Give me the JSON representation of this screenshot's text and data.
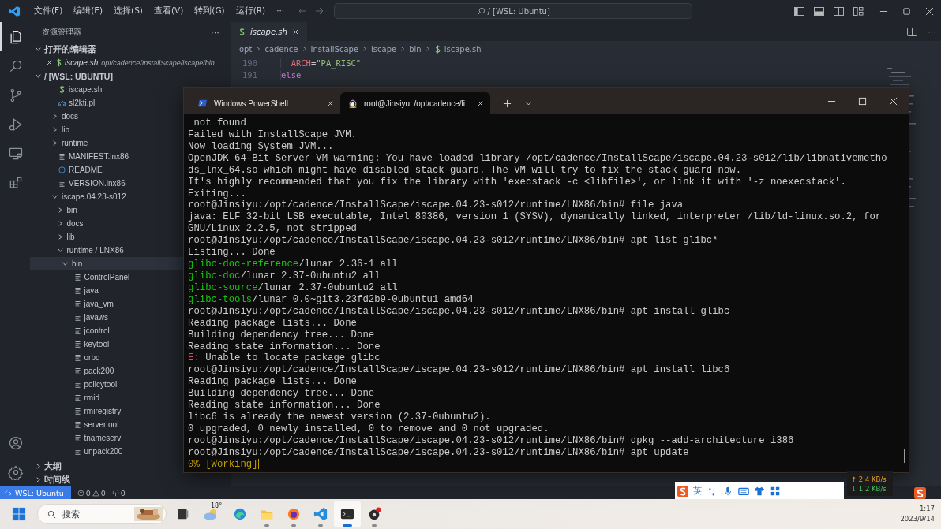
{
  "menu": [
    "文件(F)",
    "编辑(E)",
    "选择(S)",
    "查看(V)",
    "转到(G)",
    "运行(R)",
    "···"
  ],
  "command_center": {
    "text": "/ [WSL: Ubuntu]"
  },
  "activity_bar": [
    {
      "kind": "explorer",
      "selected": true
    },
    {
      "kind": "search",
      "selected": false
    },
    {
      "kind": "source-control",
      "selected": false
    },
    {
      "kind": "run",
      "selected": false
    },
    {
      "kind": "remote",
      "selected": false
    },
    {
      "kind": "extensions",
      "selected": false
    }
  ],
  "sidebar": {
    "title": "资源管理器",
    "more": "···",
    "open_editors": {
      "title": "打开的编辑器",
      "expanded": true,
      "items": [
        {
          "name": "iscape.sh",
          "path": "opt/cadence/InstallScape/iscape/bin"
        }
      ]
    },
    "workspace": {
      "title": "/ [WSL: UBUNTU]",
      "expanded": true,
      "tree": [
        {
          "label": "iscape.sh",
          "kind": "shell",
          "selected": false
        },
        {
          "label": "sl2kti.pl",
          "kind": "perl",
          "selected": false
        },
        {
          "label": "docs",
          "kind": "folder",
          "expanded": false,
          "selected": false
        },
        {
          "label": "lib",
          "kind": "folder",
          "expanded": false,
          "selected": false
        },
        {
          "label": "runtime",
          "kind": "folder",
          "expanded": false,
          "selected": false
        },
        {
          "label": "MANIFEST.lnx86",
          "kind": "text",
          "selected": false
        },
        {
          "label": "README",
          "kind": "info",
          "selected": false
        },
        {
          "label": "VERSION.lnx86",
          "kind": "text",
          "selected": false
        },
        {
          "label": "iscape.04.23-s012",
          "kind": "folder",
          "expanded": true,
          "selected": false,
          "children": [
            {
              "label": "bin",
              "kind": "folder",
              "expanded": false,
              "selected": false
            },
            {
              "label": "docs",
              "kind": "folder",
              "expanded": false,
              "selected": false
            },
            {
              "label": "lib",
              "kind": "folder",
              "expanded": false,
              "selected": false
            },
            {
              "label": "runtime / LNX86",
              "kind": "folder",
              "expanded": true,
              "selected": false,
              "children": [
                {
                  "label": "bin",
                  "kind": "folder",
                  "expanded": true,
                  "selected": true,
                  "children": [
                    {
                      "label": "ControlPanel",
                      "kind": "text",
                      "selected": false
                    },
                    {
                      "label": "java",
                      "kind": "text",
                      "selected": false
                    },
                    {
                      "label": "java_vm",
                      "kind": "text",
                      "selected": false
                    },
                    {
                      "label": "javaws",
                      "kind": "text",
                      "selected": false
                    },
                    {
                      "label": "jcontrol",
                      "kind": "text",
                      "selected": false
                    },
                    {
                      "label": "keytool",
                      "kind": "text",
                      "selected": false
                    },
                    {
                      "label": "orbd",
                      "kind": "text",
                      "selected": false
                    },
                    {
                      "label": "pack200",
                      "kind": "text",
                      "selected": false
                    },
                    {
                      "label": "policytool",
                      "kind": "text",
                      "selected": false
                    },
                    {
                      "label": "rmid",
                      "kind": "text",
                      "selected": false
                    },
                    {
                      "label": "rmiregistry",
                      "kind": "text",
                      "selected": false
                    },
                    {
                      "label": "servertool",
                      "kind": "text",
                      "selected": false
                    },
                    {
                      "label": "tnameserv",
                      "kind": "text",
                      "selected": false
                    },
                    {
                      "label": "unpack200",
                      "kind": "text",
                      "selected": false
                    }
                  ]
                }
              ]
            }
          ]
        }
      ]
    },
    "sections": [
      {
        "title": "大纲",
        "expanded": false
      },
      {
        "title": "时间线",
        "expanded": false
      }
    ]
  },
  "editor": {
    "tabs": [
      {
        "label": "iscape.sh",
        "selected": true
      }
    ],
    "breadcrumb": [
      "opt",
      "cadence",
      "InstallScape",
      "iscape",
      "bin",
      "iscape.sh"
    ],
    "lines": [
      {
        "number": "190",
        "kind": "assign",
        "name": "  ARCH",
        "op": "=",
        "value": "\"PA_RISC\""
      },
      {
        "number": "191",
        "kind": "keyword",
        "text": "else"
      }
    ]
  },
  "terminal": {
    "tabs": [
      {
        "kind": "powershell",
        "title": "Windows PowerShell",
        "selected": false
      },
      {
        "kind": "linux",
        "title": "root@Jinsiyu: /opt/cadence/li",
        "selected": true
      }
    ],
    "lines": [
      {
        "kind": "plain",
        "text": " not found"
      },
      {
        "kind": "plain",
        "text": "Failed with InstallScape JVM."
      },
      {
        "kind": "plain",
        "text": "Now loading System JVM..."
      },
      {
        "kind": "plain",
        "text": "OpenJDK 64-Bit Server VM warning: You have loaded library /opt/cadence/InstallScape/iscape.04.23-s012/lib/libnativemetho"
      },
      {
        "kind": "plain",
        "text": "ds_lnx_64.so which might have disabled stack guard. The VM will try to fix the stack guard now."
      },
      {
        "kind": "plain",
        "text": "It's highly recommended that you fix the library with 'execstack -c <libfile>', or link it with '-z noexecstack'."
      },
      {
        "kind": "plain",
        "text": "Exiting..."
      },
      {
        "kind": "plain",
        "text": "root@Jinsiyu:/opt/cadence/InstallScape/iscape.04.23-s012/runtime/LNX86/bin# file java"
      },
      {
        "kind": "plain",
        "text": "java: ELF 32-bit LSB executable, Intel 80386, version 1 (SYSV), dynamically linked, interpreter /lib/ld-linux.so.2, for"
      },
      {
        "kind": "plain",
        "text": "GNU/Linux 2.2.5, not stripped"
      },
      {
        "kind": "plain",
        "text": "root@Jinsiyu:/opt/cadence/InstallScape/iscape.04.23-s012/runtime/LNX86/bin# apt list glibc*"
      },
      {
        "kind": "plain",
        "text": "Listing... Done"
      },
      {
        "kind": "package",
        "lead": "glibc-doc-reference",
        "text": "/lunar 2.36-1 all"
      },
      {
        "kind": "package",
        "lead": "glibc-doc",
        "text": "/lunar 2.37-0ubuntu2 all"
      },
      {
        "kind": "package",
        "lead": "glibc-source",
        "text": "/lunar 2.37-0ubuntu2 all"
      },
      {
        "kind": "package",
        "lead": "glibc-tools",
        "text": "/lunar 0.0~git3.23fd2b9-0ubuntu1 amd64"
      },
      {
        "kind": "plain",
        "text": "root@Jinsiyu:/opt/cadence/InstallScape/iscape.04.23-s012/runtime/LNX86/bin# apt install glibc"
      },
      {
        "kind": "plain",
        "text": "Reading package lists... Done"
      },
      {
        "kind": "plain",
        "text": "Building dependency tree... Done"
      },
      {
        "kind": "plain",
        "text": "Reading state information... Done"
      },
      {
        "kind": "error",
        "lead": "E:",
        "text": " Unable to locate package glibc"
      },
      {
        "kind": "plain",
        "text": "root@Jinsiyu:/opt/cadence/InstallScape/iscape.04.23-s012/runtime/LNX86/bin# apt install libc6"
      },
      {
        "kind": "plain",
        "text": "Reading package lists... Done"
      },
      {
        "kind": "plain",
        "text": "Building dependency tree... Done"
      },
      {
        "kind": "plain",
        "text": "Reading state information... Done"
      },
      {
        "kind": "plain",
        "text": "libc6 is already the newest version (2.37-0ubuntu2)."
      },
      {
        "kind": "plain",
        "text": "0 upgraded, 0 newly installed, 0 to remove and 0 not upgraded."
      },
      {
        "kind": "plain",
        "text": "root@Jinsiyu:/opt/cadence/InstallScape/iscape.04.23-s012/runtime/LNX86/bin# dpkg --add-architecture i386"
      },
      {
        "kind": "plain",
        "text": "root@Jinsiyu:/opt/cadence/InstallScape/iscape.04.23-s012/runtime/LNX86/bin# apt update"
      },
      {
        "kind": "progress",
        "text": "0% [Working]"
      }
    ]
  },
  "status_bar": {
    "remote": "WSL: Ubuntu",
    "errors": "0",
    "warnings": "0",
    "ports": "0"
  },
  "net_speed": {
    "up": "↑ 2.4 KB/s",
    "down": "↓ 1.2 KB/s"
  },
  "ime": {
    "mode": "英"
  },
  "taskbar": {
    "search_placeholder": "搜索",
    "weather": "18°",
    "apps": [
      {
        "kind": "edge",
        "running": false,
        "selected": false
      },
      {
        "kind": "files",
        "running": true,
        "selected": false
      },
      {
        "kind": "firefox",
        "running": true,
        "selected": false
      },
      {
        "kind": "vscode",
        "running": true,
        "selected": false
      },
      {
        "kind": "terminal",
        "running": true,
        "selected": true
      },
      {
        "kind": "recorder",
        "running": true,
        "selected": false
      }
    ],
    "time": "1:17",
    "date": "2023/9/14"
  }
}
